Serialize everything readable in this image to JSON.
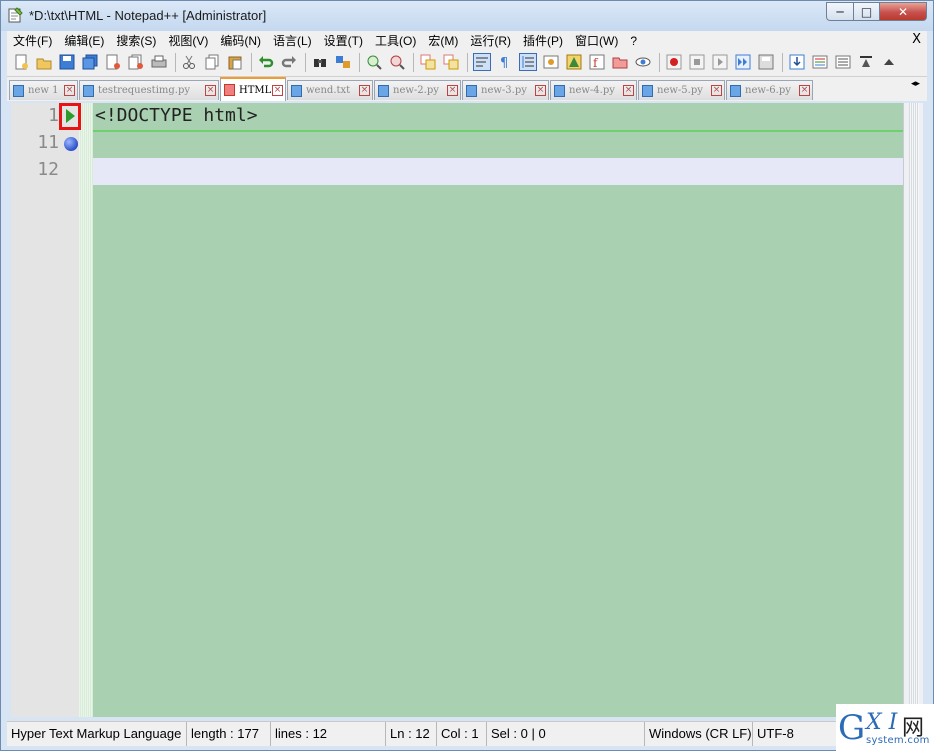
{
  "window": {
    "title": "*D:\\txt\\HTML - Notepad++ [Administrator]",
    "minimize": "─",
    "maximize": "□",
    "close": "✕"
  },
  "menu": {
    "items": [
      "文件(F)",
      "编辑(E)",
      "搜索(S)",
      "视图(V)",
      "编码(N)",
      "语言(L)",
      "设置(T)",
      "工具(O)",
      "宏(M)",
      "运行(R)",
      "插件(P)",
      "窗口(W)",
      "?"
    ],
    "close": "X"
  },
  "toolbar": {
    "icons": [
      "new-file-icon",
      "open-file-icon",
      "save-icon",
      "save-all-icon",
      "close-icon",
      "close-all-icon",
      "print-icon",
      "cut-icon",
      "copy-icon",
      "paste-icon",
      "undo-icon",
      "redo-icon",
      "find-icon",
      "replace-icon",
      "zoom-in-icon",
      "zoom-out-icon",
      "sync-v-icon",
      "sync-h-icon",
      "word-wrap-icon",
      "show-all-chars-icon",
      "indent-guide-icon",
      "user-lang-icon",
      "doc-map-icon",
      "function-list-icon",
      "folder-workspace-icon",
      "monitor-icon",
      "record-macro-icon",
      "stop-macro-icon",
      "play-macro-icon",
      "run-macro-multiple-icon",
      "save-macro-icon",
      "run-icon",
      "compare-icon",
      "compare-2-icon",
      "compare-3-icon",
      "up-icon"
    ]
  },
  "tabs": [
    {
      "label": "new 1",
      "active": false
    },
    {
      "label": "testrequestimg.py",
      "active": false
    },
    {
      "label": "HTML",
      "active": true
    },
    {
      "label": "wend.txt",
      "active": false
    },
    {
      "label": "new-2.py",
      "active": false
    },
    {
      "label": "new-3.py",
      "active": false
    },
    {
      "label": "new-4.py",
      "active": false
    },
    {
      "label": "new-5.py",
      "active": false
    },
    {
      "label": "new-6.py",
      "active": false
    }
  ],
  "editor": {
    "lines": [
      {
        "number": "1",
        "text": "<!DOCTYPE html>"
      },
      {
        "number": "11",
        "text": ""
      },
      {
        "number": "12",
        "text": ""
      }
    ],
    "background": "#a9d1b1",
    "current_line_color": "#e6e8f8"
  },
  "status": {
    "language": "Hyper Text Markup Language",
    "length": "length : 177",
    "lines": "lines : 12",
    "ln": "Ln : 12",
    "col": "Col : 1",
    "sel": "Sel : 0 | 0",
    "eol": "Windows (CR LF)",
    "encoding": "UTF-8"
  },
  "watermark": {
    "g": "G",
    "xi": "X I",
    "net": "网",
    "site": "system.com"
  }
}
